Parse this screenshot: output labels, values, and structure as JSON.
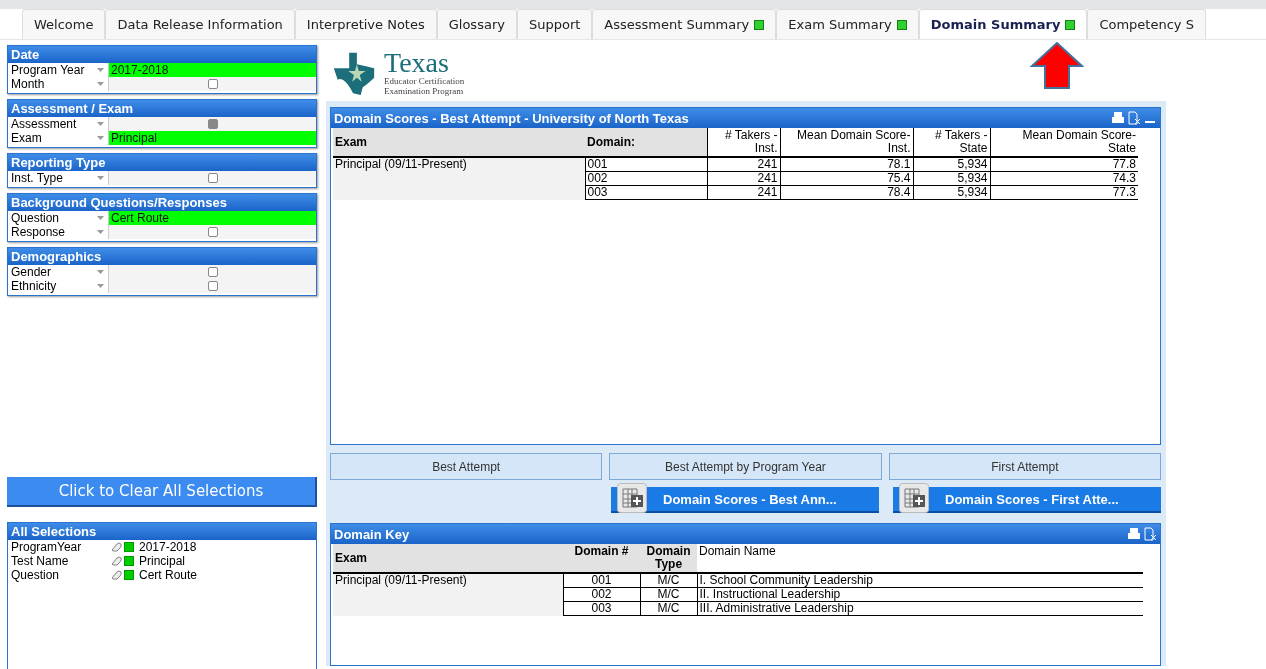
{
  "tabs": [
    {
      "label": "Welcome",
      "selected": false,
      "indicator": false
    },
    {
      "label": "Data Release Information",
      "selected": false,
      "indicator": false
    },
    {
      "label": "Interpretive Notes",
      "selected": false,
      "indicator": false
    },
    {
      "label": "Glossary",
      "selected": false,
      "indicator": false
    },
    {
      "label": "Support",
      "selected": false,
      "indicator": false
    },
    {
      "label": "Assessment Summary",
      "selected": false,
      "indicator": true
    },
    {
      "label": "Exam Summary",
      "selected": false,
      "indicator": true
    },
    {
      "label": "Domain Summary",
      "selected": true,
      "indicator": true
    },
    {
      "label": "Competency S",
      "selected": false,
      "indicator": false
    }
  ],
  "filter_panels": [
    {
      "title": "Date",
      "rows": [
        {
          "label": "Program Year",
          "value": "2017-2018"
        },
        {
          "label": "Month",
          "filled": false
        }
      ]
    },
    {
      "title": "Assessment / Exam",
      "rows": [
        {
          "label": "Assessment",
          "filled": true
        },
        {
          "label": "Exam",
          "value": "Principal"
        }
      ]
    },
    {
      "title": "Reporting Type",
      "rows": [
        {
          "label": "Inst. Type",
          "filled": false
        }
      ]
    },
    {
      "title": "Background Questions/Responses",
      "rows": [
        {
          "label": "Question",
          "value": "Cert Route"
        },
        {
          "label": "Response",
          "filled": false
        }
      ]
    },
    {
      "title": "Demographics",
      "rows": [
        {
          "label": "Gender",
          "filled": false
        },
        {
          "label": "Ethnicity",
          "filled": false
        }
      ]
    }
  ],
  "clear_button": "Click to Clear All Selections",
  "all_selections": {
    "title": "All Selections",
    "rows": [
      {
        "field": "ProgramYear",
        "value": "2017-2018"
      },
      {
        "field": "Test Name",
        "value": "Principal"
      },
      {
        "field": "Question",
        "value": "Cert Route"
      }
    ]
  },
  "logo": {
    "title": "Texas",
    "line_1": "Educator Certification",
    "line_2": "Examination Program"
  },
  "domain_scores": {
    "title": "Domain Scores - Best Attempt - University of North Texas",
    "columns": [
      "Exam",
      "Domain:",
      "# Takers -\nInst.",
      "Mean Domain Score-\nInst.",
      "# Takers -\nState",
      "Mean Domain Score-\nState"
    ],
    "exam": "Principal (09/11-Present)",
    "rows": [
      {
        "domain": "001",
        "takers_inst": "241",
        "mean_inst": "78.1",
        "takers_state": "5,934",
        "mean_state": "77.8"
      },
      {
        "domain": "002",
        "takers_inst": "241",
        "mean_inst": "75.4",
        "takers_state": "5,934",
        "mean_state": "74.3"
      },
      {
        "domain": "003",
        "takers_inst": "241",
        "mean_inst": "78.4",
        "takers_state": "5,934",
        "mean_state": "77.3"
      }
    ]
  },
  "view_buttons": [
    "Best Attempt",
    "Best Attempt by Program Year",
    "First Attempt"
  ],
  "export_buttons": [
    "Domain Scores - Best Ann...",
    "Domain Scores - First Atte..."
  ],
  "domain_key": {
    "title": "Domain Key",
    "columns": [
      "Exam",
      "Domain #",
      "Domain\nType",
      "Domain Name"
    ],
    "exam": "Principal (09/11-Present)",
    "rows": [
      {
        "number": "001",
        "type": "M/C",
        "name": "I. School Community Leadership"
      },
      {
        "number": "002",
        "type": "M/C",
        "name": "II. Instructional Leadership"
      },
      {
        "number": "003",
        "type": "M/C",
        "name": "III. Administrative Leadership"
      }
    ]
  }
}
